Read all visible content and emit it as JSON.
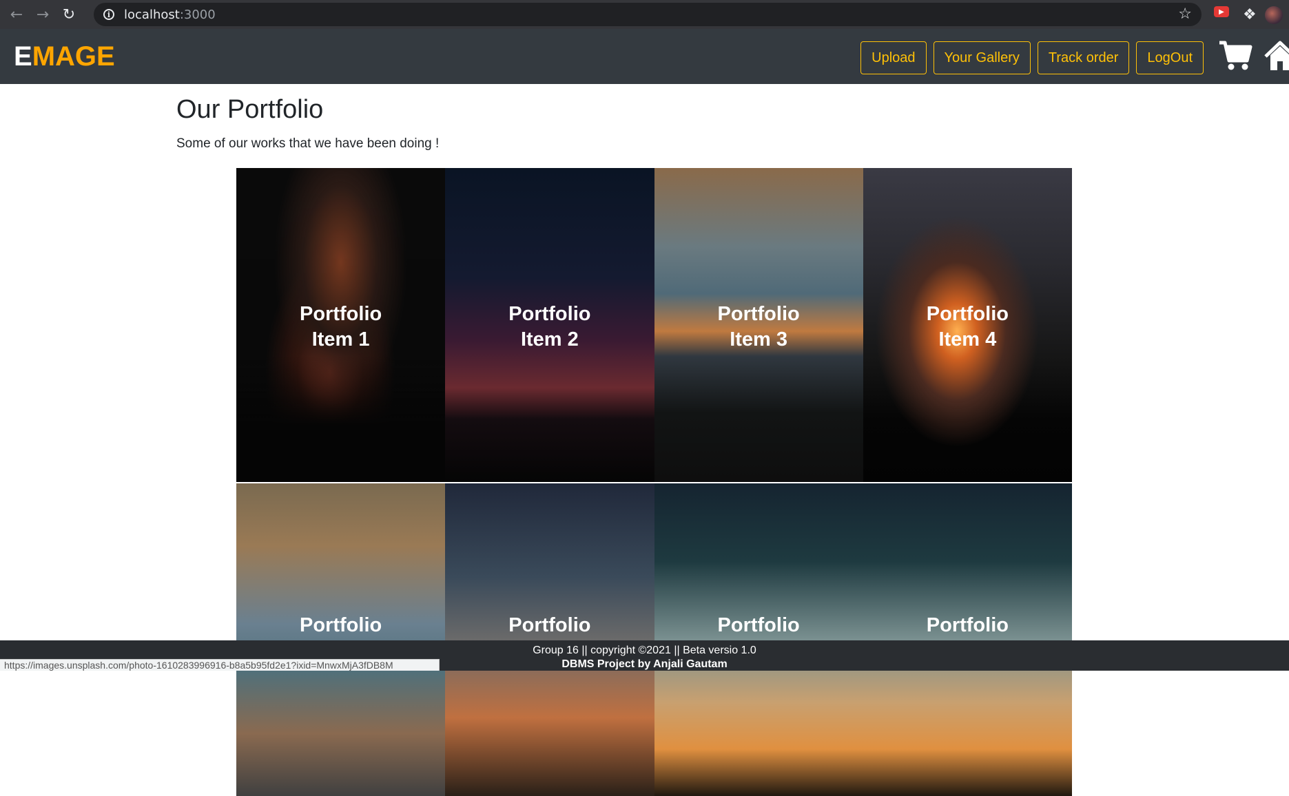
{
  "browser": {
    "url_host": "localhost",
    "url_port": ":3000",
    "status_url": "https://images.unsplash.com/photo-1610283996916-b8a5b95fd2e1?ixid=MnwxMjA3fDB8M"
  },
  "navbar": {
    "brand_first": "E",
    "brand_rest": "MAGE",
    "buttons": [
      "Upload",
      "Your Gallery",
      "Track order",
      "LogOut"
    ]
  },
  "page": {
    "title": "Our Portfolio",
    "subtitle": "Some of our works that we have been doing !"
  },
  "portfolio": {
    "items": [
      {
        "line1": "Portfolio",
        "line2": "Item 1"
      },
      {
        "line1": "Portfolio",
        "line2": "Item 2"
      },
      {
        "line1": "Portfolio",
        "line2": "Item 3"
      },
      {
        "line1": "Portfolio",
        "line2": "Item 4"
      },
      {
        "line1": "Portfolio"
      },
      {
        "line1": "Portfolio"
      },
      {
        "line1": "Portfolio"
      },
      {
        "line1": "Portfolio"
      }
    ]
  },
  "footer": {
    "line1": "Group 16 || copyright ©2021 || Beta versio 1.0",
    "line2": "DBMS Project by Anjali Gautam"
  },
  "colors": {
    "navbar_bg": "#343a40",
    "accent": "#ffc107",
    "brand_orange": "#ffa500"
  },
  "icons": {
    "cart": "cart-icon",
    "home": "home-icon"
  }
}
